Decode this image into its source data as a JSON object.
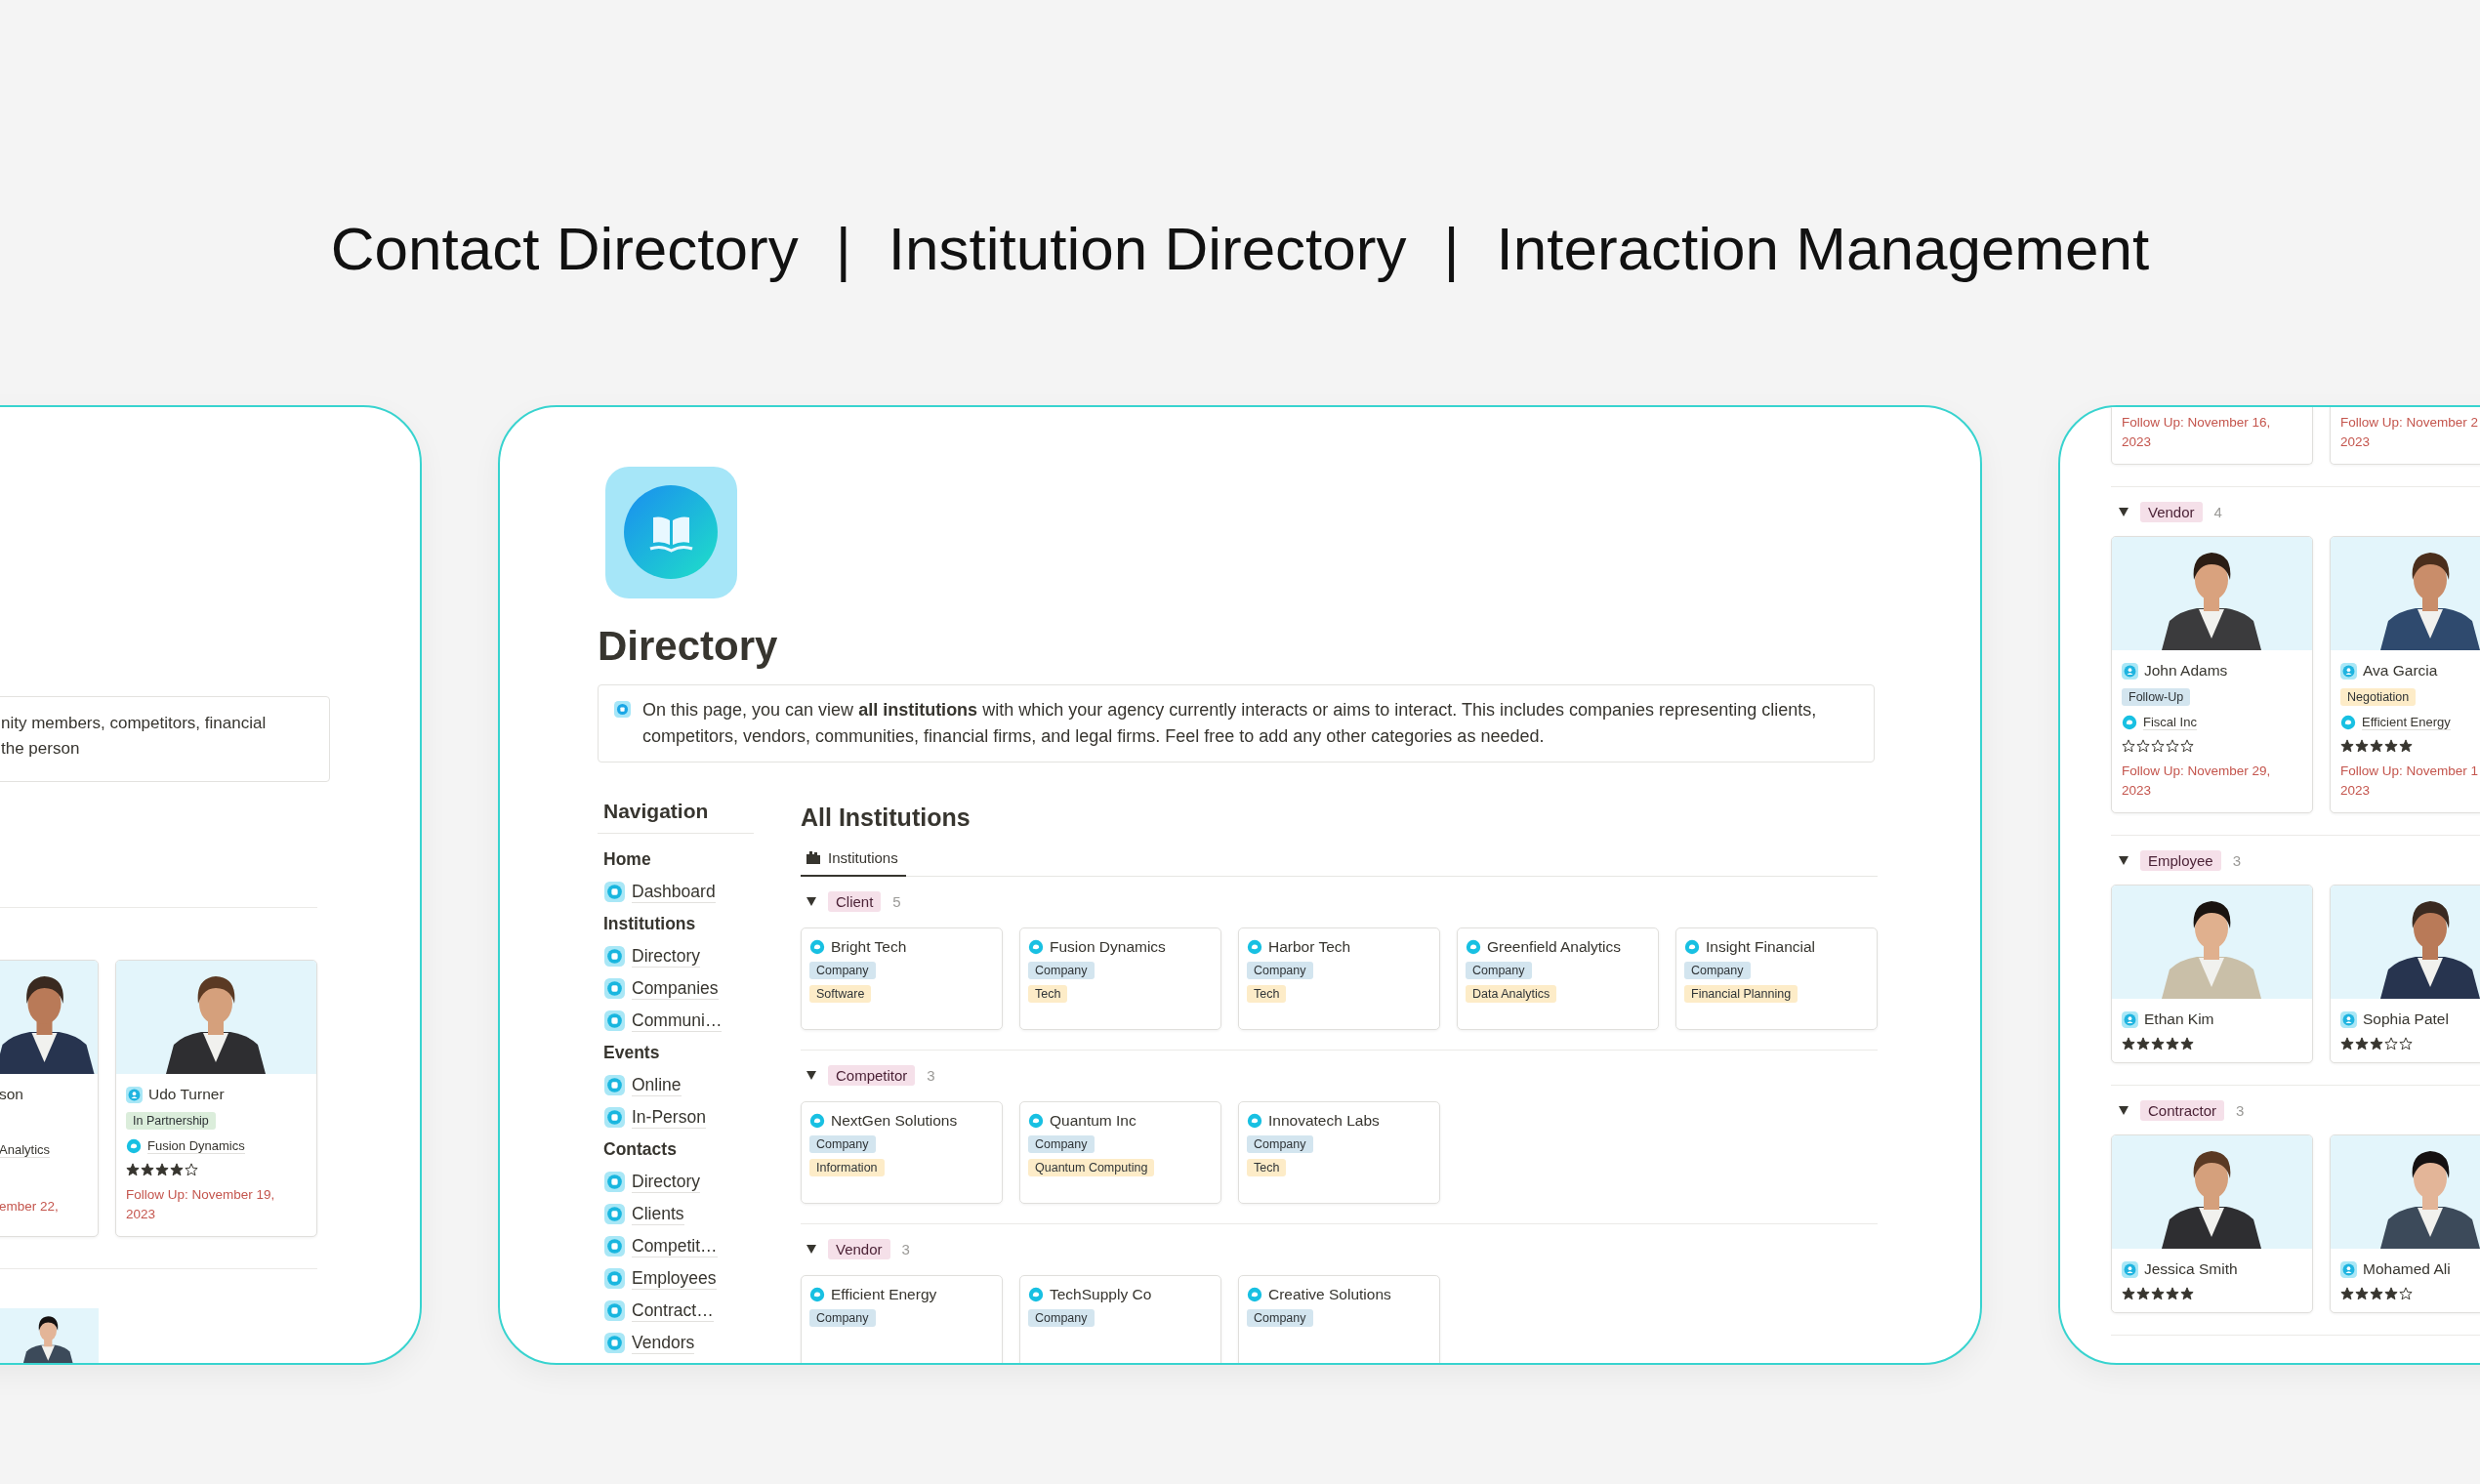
{
  "headline": [
    "Contact Directory",
    "|",
    "Institution Directory",
    "|",
    "Interaction Management"
  ],
  "left_panel": {
    "callout_lines": [
      "nity members, competitors, financial",
      "the person"
    ],
    "cards": [
      {
        "name": "son",
        "company": "Analytics",
        "follow_up": [
          "ember 22,"
        ]
      },
      {
        "name": "Udo Turner",
        "status": {
          "text": "In Partnership",
          "color": "#dbeddb"
        },
        "company": "Fusion Dynamics",
        "stars": 4,
        "follow_up": [
          "Follow Up: November 19,",
          "2023"
        ]
      }
    ],
    "next_cards": [
      {
        "kind": "picture"
      }
    ]
  },
  "page": {
    "title": "Directory",
    "callout": "On this page, you can view **all institutions** with which your agency currently interacts or aims to interact. This includes companies representing clients, competitors, vendors, communities, financial firms, and legal firms. Feel free to add any other categories as needed.",
    "navigation": {
      "title": "Navigation",
      "sections": [
        {
          "label": "Home",
          "items": [
            "Dashboard"
          ]
        },
        {
          "label": "Institutions",
          "items": [
            "Directory",
            "Companies",
            "Communi…"
          ]
        },
        {
          "label": "Events",
          "items": [
            "Online",
            "In-Person"
          ]
        },
        {
          "label": "Contacts",
          "items": [
            "Directory",
            "Clients",
            "Competit…",
            "Employees",
            "Contract…",
            "Vendors"
          ]
        }
      ]
    },
    "database": {
      "title": "All Institutions",
      "tabs": [
        {
          "label": "Institutions",
          "selected": true
        }
      ],
      "groups": [
        {
          "label": "Client",
          "count": "5",
          "cards": [
            {
              "name": "Bright Tech",
              "tags": [
                {
                  "text": "Company",
                  "color": "#d3e5ef"
                },
                {
                  "text": "Software",
                  "color": "#fdecc8"
                }
              ]
            },
            {
              "name": "Fusion Dynamics",
              "tags": [
                {
                  "text": "Company",
                  "color": "#d3e5ef"
                },
                {
                  "text": "Tech",
                  "color": "#fdecc8"
                }
              ]
            },
            {
              "name": "Harbor Tech",
              "tags": [
                {
                  "text": "Company",
                  "color": "#d3e5ef"
                },
                {
                  "text": "Tech",
                  "color": "#fdecc8"
                }
              ]
            },
            {
              "name": "Greenfield Analytics",
              "tags": [
                {
                  "text": "Company",
                  "color": "#d3e5ef"
                },
                {
                  "text": "Data Analytics",
                  "color": "#fdecc8"
                }
              ]
            },
            {
              "name": "Insight Financial",
              "tags": [
                {
                  "text": "Company",
                  "color": "#d3e5ef"
                },
                {
                  "text": "Financial Planning",
                  "color": "#fdecc8"
                }
              ]
            }
          ]
        },
        {
          "label": "Competitor",
          "count": "3",
          "cards": [
            {
              "name": "NextGen Solutions",
              "tags": [
                {
                  "text": "Company",
                  "color": "#d3e5ef"
                },
                {
                  "text": "Information",
                  "color": "#fdecc8"
                }
              ]
            },
            {
              "name": "Quantum Inc",
              "tags": [
                {
                  "text": "Company",
                  "color": "#d3e5ef"
                },
                {
                  "text": "Quantum Computing",
                  "color": "#fdecc8"
                }
              ]
            },
            {
              "name": "Innovatech Labs",
              "tags": [
                {
                  "text": "Company",
                  "color": "#d3e5ef"
                },
                {
                  "text": "Tech",
                  "color": "#fdecc8"
                }
              ]
            }
          ]
        },
        {
          "label": "Vendor",
          "count": "3",
          "cards": [
            {
              "name": "Efficient Energy",
              "tags": [
                {
                  "text": "Company",
                  "color": "#d3e5ef"
                }
              ]
            },
            {
              "name": "TechSupply Co",
              "tags": [
                {
                  "text": "Company",
                  "color": "#d3e5ef"
                }
              ]
            },
            {
              "name": "Creative Solutions",
              "tags": [
                {
                  "text": "Company",
                  "color": "#d3e5ef"
                }
              ]
            }
          ]
        }
      ]
    }
  },
  "right_panel": {
    "top_cards": [
      {
        "follow_up": [
          "Follow Up: November 16,",
          "2023"
        ]
      },
      {
        "follow_up": [
          "Follow Up: November 2",
          "2023"
        ]
      }
    ],
    "groups": [
      {
        "label": "Vendor",
        "count": "4",
        "cards": [
          {
            "name": "John Adams",
            "status": {
              "text": "Follow-Up",
              "color": "#d3e5ef"
            },
            "company": "Fiscal Inc",
            "stars": 0,
            "follow_up": [
              "Follow Up: November 29,",
              "2023"
            ]
          },
          {
            "name": "Ava Garcia",
            "status": {
              "text": "Negotiation",
              "color": "#fdecc8"
            },
            "company": "Efficient Energy",
            "stars": 5,
            "follow_up": [
              "Follow Up: November 1",
              "2023"
            ]
          }
        ]
      },
      {
        "label": "Employee",
        "count": "3",
        "cards": [
          {
            "name": "Ethan Kim",
            "stars": 5
          },
          {
            "name": "Sophia Patel",
            "stars": 3
          }
        ]
      },
      {
        "label": "Contractor",
        "count": "3",
        "cards": [
          {
            "name": "Jessica Smith",
            "stars": 5
          },
          {
            "name": "Mohamed Ali",
            "stars": 4
          }
        ]
      }
    ]
  }
}
